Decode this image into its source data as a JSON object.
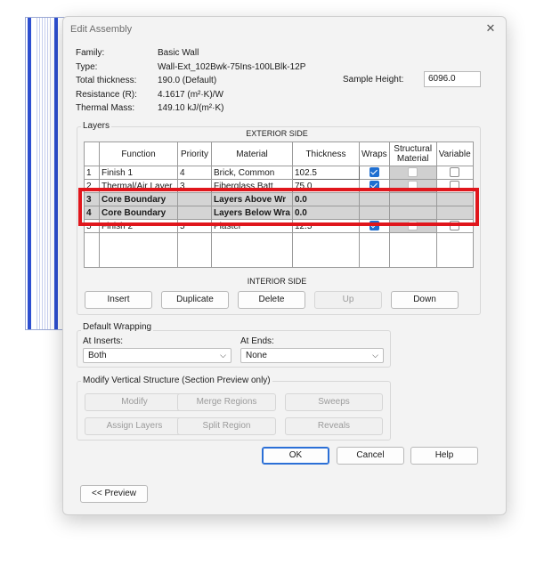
{
  "dialog": {
    "title": "Edit Assembly",
    "close_icon": "close-icon"
  },
  "info": {
    "family_label": "Family:",
    "family_value": "Basic Wall",
    "type_label": "Type:",
    "type_value": "Wall-Ext_102Bwk-75Ins-100LBlk-12P",
    "thickness_label": "Total thickness:",
    "thickness_value": "190.0 (Default)",
    "resistance_label": "Resistance (R):",
    "resistance_value": "4.1617 (m²·K)/W",
    "mass_label": "Thermal Mass:",
    "mass_value": "149.10 kJ/(m²·K)",
    "sample_label": "Sample Height:",
    "sample_value": "6096.0"
  },
  "layers": {
    "group_label": "Layers",
    "exterior_caption": "EXTERIOR SIDE",
    "interior_caption": "INTERIOR SIDE",
    "columns": [
      "Function",
      "Priority",
      "Material",
      "Thickness",
      "Wraps",
      "Structural Material",
      "Variable"
    ],
    "rows": [
      {
        "num": "1",
        "function": "Finish 1",
        "priority": "4",
        "material": "Brick, Common",
        "thickness": "102.5",
        "wraps": true,
        "structural": false,
        "variable": false
      },
      {
        "num": "2",
        "function": "Thermal/Air Layer",
        "priority": "3",
        "material": "Fiberglass Batt",
        "thickness": "75.0",
        "wraps": true,
        "structural": false,
        "variable": false
      },
      {
        "num": "3",
        "function": "Core Boundary",
        "priority": "",
        "material": "Layers Above Wr",
        "thickness": "0.0"
      },
      {
        "num": "4",
        "function": "Core Boundary",
        "priority": "",
        "material": "Layers Below Wra",
        "thickness": "0.0"
      },
      {
        "num": "5",
        "function": "Finish 2",
        "priority": "5",
        "material": "Plaster",
        "thickness": "12.5",
        "wraps": true,
        "structural": false,
        "variable": false
      }
    ],
    "buttons": {
      "insert": "Insert",
      "duplicate": "Duplicate",
      "delete": "Delete",
      "up": "Up",
      "down": "Down"
    }
  },
  "wrapping": {
    "group_label": "Default Wrapping",
    "inserts_label": "At Inserts:",
    "inserts_value": "Both",
    "ends_label": "At Ends:",
    "ends_value": "None"
  },
  "vertical": {
    "group_label": "Modify Vertical Structure (Section Preview only)",
    "modify": "Modify",
    "merge": "Merge Regions",
    "sweeps": "Sweeps",
    "assign": "Assign Layers",
    "split": "Split Region",
    "reveals": "Reveals"
  },
  "footer": {
    "ok": "OK",
    "cancel": "Cancel",
    "help": "Help",
    "preview": "<< Preview"
  },
  "colors": {
    "highlight": "#e0161c",
    "accent": "#2b6fd6",
    "core_row": "#d4d4d4"
  }
}
